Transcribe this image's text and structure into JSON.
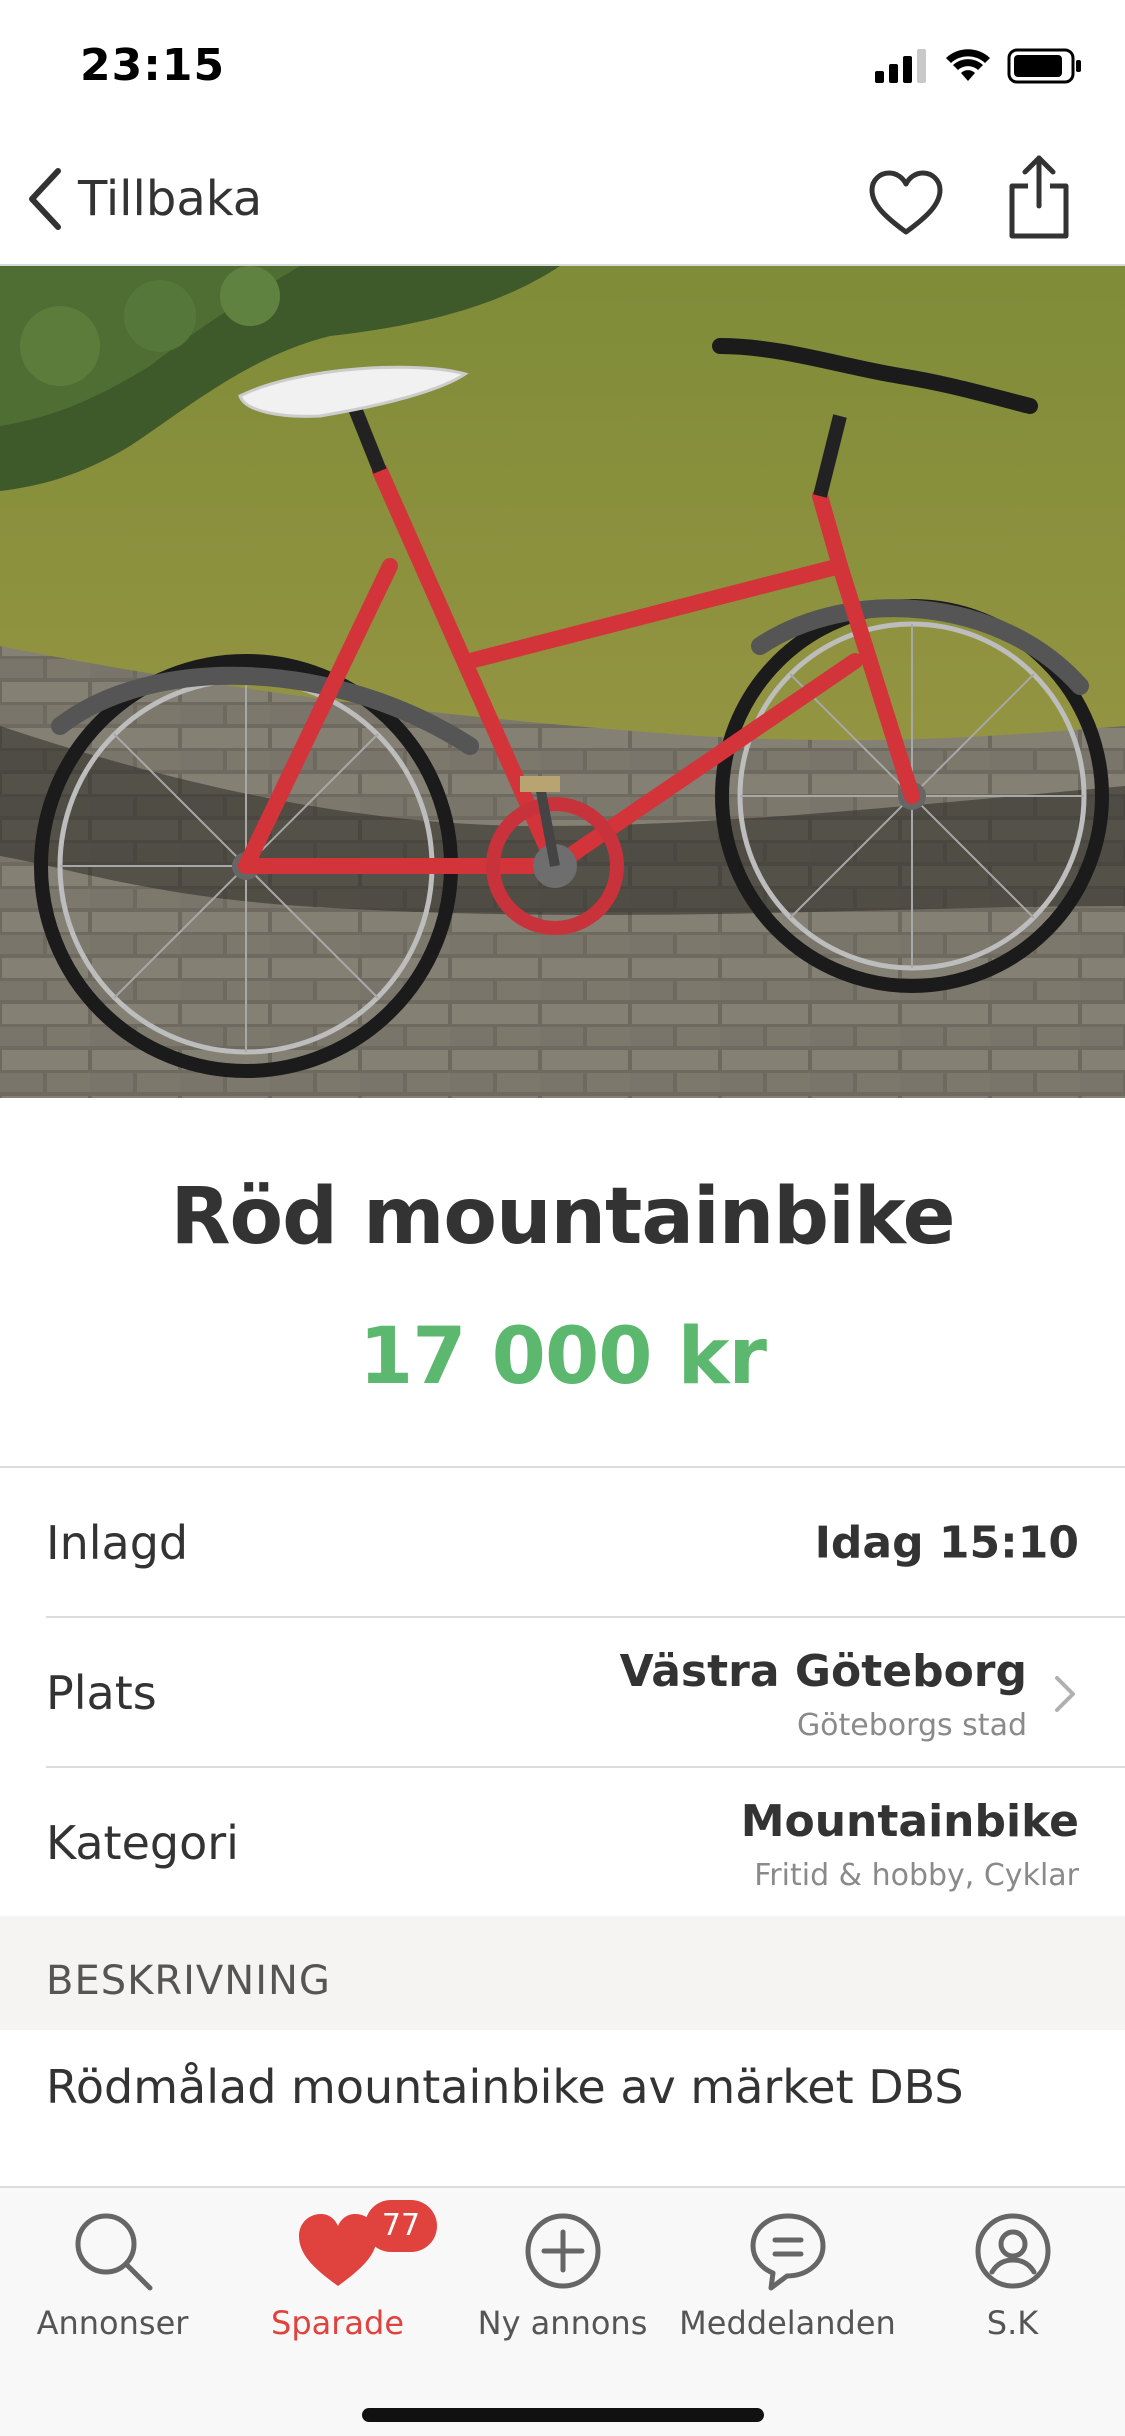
{
  "status_bar": {
    "time": "23:15"
  },
  "nav": {
    "back_label": "Tillbaka",
    "heart_icon": "heart-outline-icon",
    "share_icon": "share-icon"
  },
  "listing": {
    "title": "Röd mountainbike",
    "price": "17 000 kr",
    "photo_description_icon": "bicycle-photo"
  },
  "info": {
    "posted": {
      "label": "Inlagd",
      "value": "Idag 15:10"
    },
    "place": {
      "label": "Plats",
      "value": "Västra Göteborg",
      "sub": "Göteborgs stad"
    },
    "category": {
      "label": "Kategori",
      "value": "Mountainbike",
      "sub": "Fritid & hobby, Cyklar"
    }
  },
  "description": {
    "header": "BESKRIVNING",
    "text": "Rödmålad mountainbike av märket DBS"
  },
  "tabs": [
    {
      "label": "Annonser",
      "icon": "search-icon"
    },
    {
      "label": "Sparade",
      "icon": "heart-icon",
      "badge": "77",
      "active": true
    },
    {
      "label": "Ny annons",
      "icon": "plus-circle-icon"
    },
    {
      "label": "Meddelanden",
      "icon": "chat-icon"
    },
    {
      "label": "S.K",
      "icon": "profile-icon"
    }
  ],
  "colors": {
    "price": "#5cb86e",
    "accent": "#e0423e"
  }
}
